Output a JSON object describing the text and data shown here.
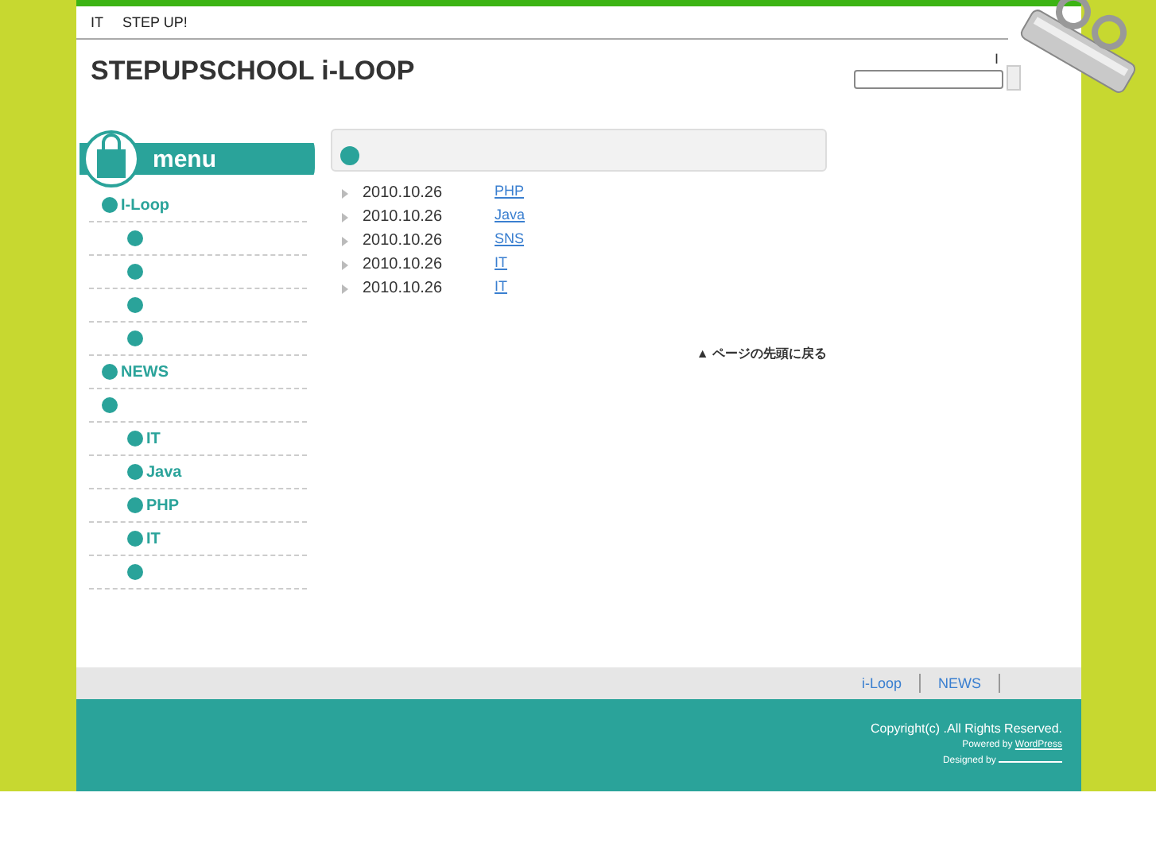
{
  "top_nav": [
    "IT",
    "STEP UP!"
  ],
  "site_title": "STEPUPSCHOOL i-LOOP",
  "search": {
    "label": "I"
  },
  "sidebar": {
    "heading": "menu",
    "items": [
      {
        "kind": "link",
        "label": "I-Loop",
        "children": [
          {
            "kind": "blank"
          },
          {
            "kind": "blank"
          },
          {
            "kind": "blank"
          },
          {
            "kind": "blank"
          }
        ]
      },
      {
        "kind": "link",
        "label": "NEWS"
      },
      {
        "kind": "blank",
        "children": [
          {
            "kind": "link",
            "label": "IT"
          },
          {
            "kind": "link",
            "label": "Java"
          },
          {
            "kind": "link",
            "label": "PHP"
          },
          {
            "kind": "link",
            "label": "IT"
          },
          {
            "kind": "blank"
          }
        ]
      }
    ]
  },
  "posts": [
    {
      "date": "2010.10.26",
      "title": "PHP"
    },
    {
      "date": "2010.10.26",
      "title": "Java"
    },
    {
      "date": "2010.10.26",
      "title": "SNS"
    },
    {
      "date": "2010.10.26",
      "title": "IT"
    },
    {
      "date": "2010.10.26",
      "title": "IT"
    }
  ],
  "back_to_top": "▲ ページの先頭に戻る",
  "footer_nav": [
    {
      "kind": "link",
      "label": "i-Loop"
    },
    {
      "kind": "link",
      "label": "NEWS"
    },
    {
      "kind": "blank"
    }
  ],
  "footer": {
    "copyright": "Copyright(c)   .All Rights Reserved.",
    "powered_prefix": "Powered by",
    "powered_link": "WordPress",
    "designed_prefix": "Designed by"
  }
}
